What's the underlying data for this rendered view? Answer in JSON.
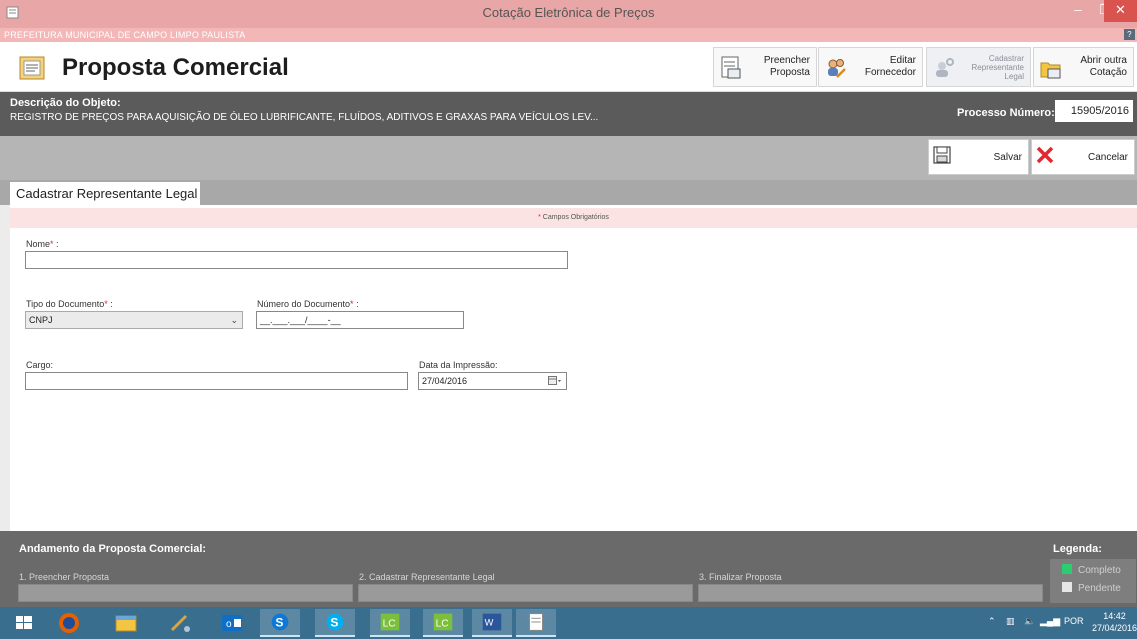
{
  "window": {
    "title": "Cotação Eletrônica de Preços",
    "organization": "PREFEITURA MUNICIPAL DE CAMPO LIMPO PAULISTA"
  },
  "header": {
    "title": "Proposta Comercial",
    "toolbar": [
      {
        "label_line1": "Preencher",
        "label_line2": "Proposta",
        "icon": "document-form-icon",
        "enabled": true
      },
      {
        "label_line1": "Editar",
        "label_line2": "Fornecedor",
        "icon": "users-edit-icon",
        "enabled": true
      },
      {
        "label_line1": "Cadastrar",
        "label_line2": "Representante",
        "label_line3": "Legal",
        "icon": "user-gear-icon",
        "enabled": false
      },
      {
        "label_line1": "Abrir outra",
        "label_line2": "Cotação",
        "icon": "folder-open-icon",
        "enabled": true
      }
    ]
  },
  "object": {
    "label": "Descrição do Objeto:",
    "value": "REGISTRO DE PREÇOS PARA AQUISIÇÃO DE ÓLEO LUBRIFICANTE, FLUÍDOS, ADITIVOS E GRAXAS PARA VEÍCULOS LEV...",
    "process_label": "Processo Número:",
    "process_value": "15905/2016"
  },
  "actions": {
    "save_label": "Salvar",
    "cancel_label": "Cancelar"
  },
  "tab": {
    "label": "Cadastrar Representante Legal"
  },
  "form": {
    "required_note": "Campos Obrigatórios",
    "required_mark": "*",
    "name_label": "Nome",
    "name_value": "",
    "doctype_label": "Tipo do Documento",
    "doctype_value": "CNPJ",
    "docnum_label": "Número do Documento",
    "docnum_value": "__.___.___/____-__",
    "role_label": "Cargo:",
    "role_value": "",
    "date_label": "Data da Impressão:",
    "date_value": "27/04/2016"
  },
  "progress": {
    "title": "Andamento da Proposta Comercial:",
    "steps": [
      {
        "label": "1. Preencher Proposta",
        "status": "pendente"
      },
      {
        "label": "2. Cadastrar Representante Legal",
        "status": "pendente"
      },
      {
        "label": "3. Finalizar Proposta",
        "status": "pendente"
      }
    ],
    "legend_title": "Legenda:",
    "legend": [
      {
        "label": "Completo",
        "color": "#2ecc71"
      },
      {
        "label": "Pendente",
        "color": "#e6e6e6"
      }
    ]
  },
  "taskbar": {
    "language": "POR",
    "time": "14:42",
    "date": "27/04/2016"
  },
  "colors": {
    "titlebar": "#e9a6a6",
    "close": "#d9534f",
    "band_dark": "#5b5b5b",
    "band_light": "#b5b5b5",
    "required": "#e0282e",
    "completo": "#2ecc71"
  }
}
